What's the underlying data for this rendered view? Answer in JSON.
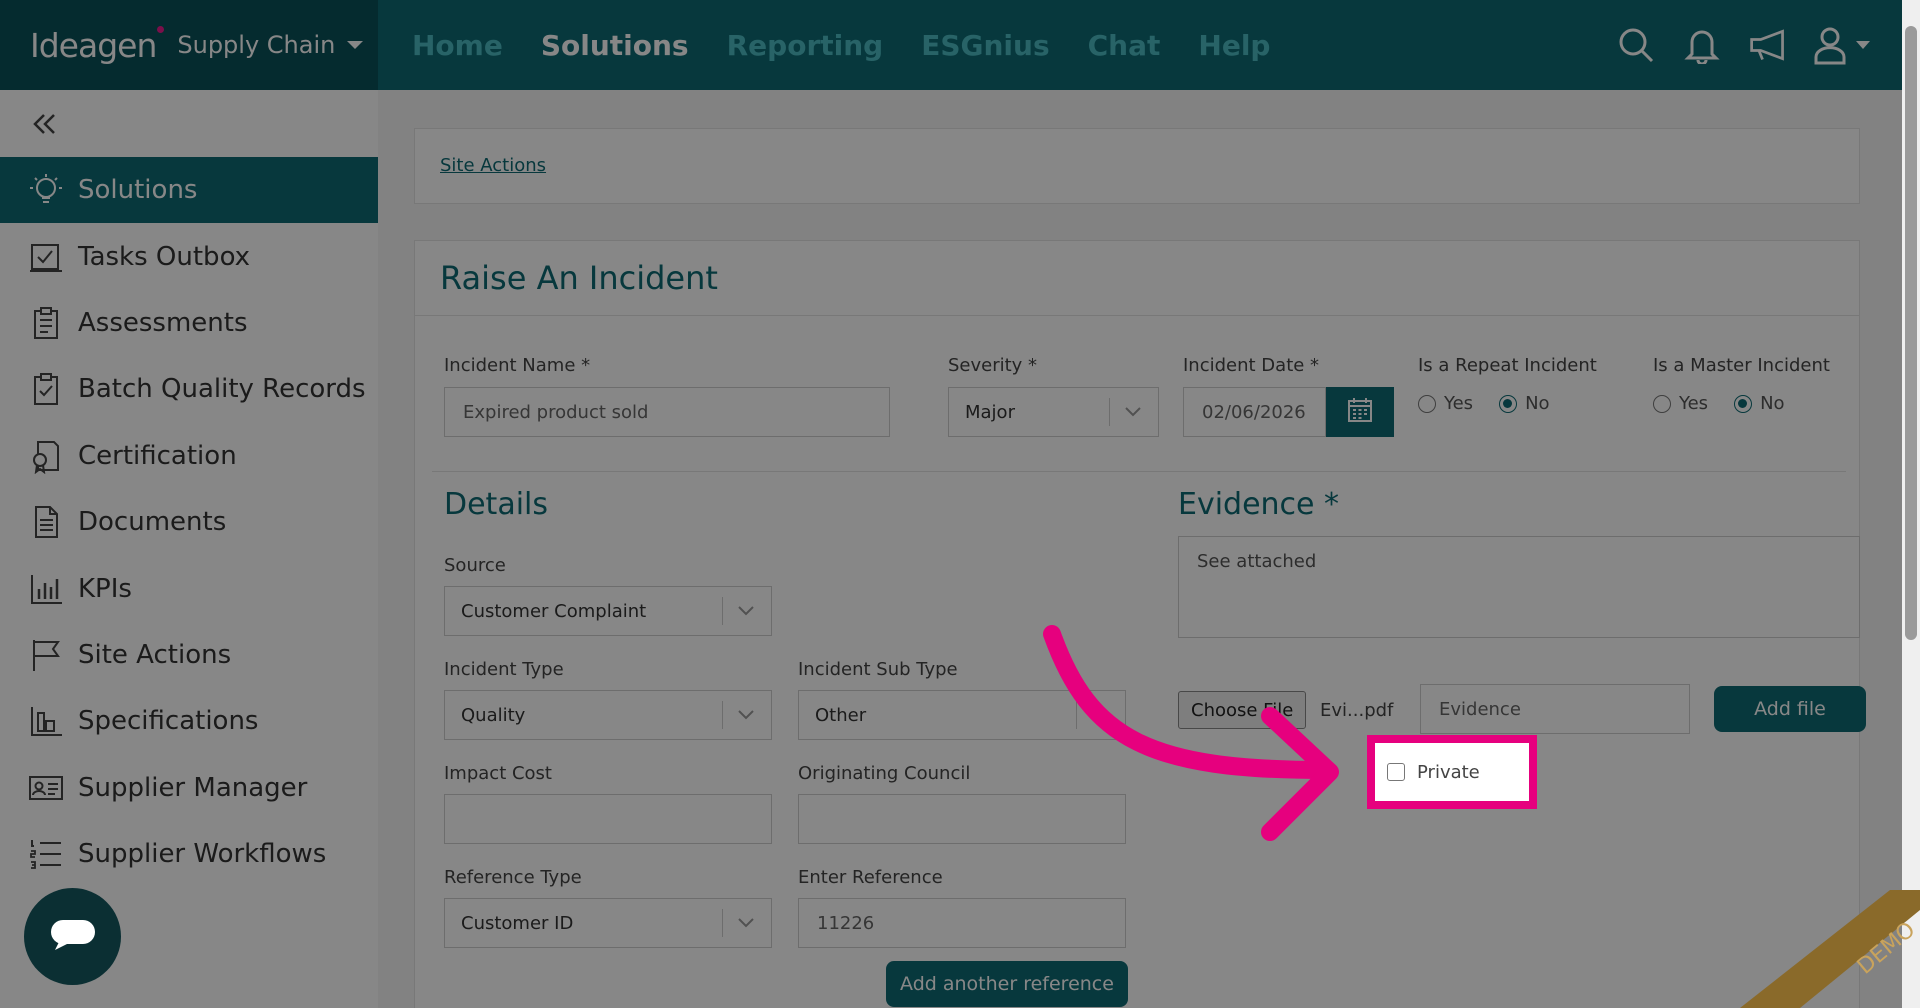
{
  "brand": {
    "logo": "Ideagen",
    "product": "Supply Chain"
  },
  "nav": [
    "Home",
    "Solutions",
    "Reporting",
    "ESGnius",
    "Chat",
    "Help"
  ],
  "nav_active_index": 1,
  "topicons": [
    "search-icon",
    "bell-icon",
    "megaphone-icon",
    "user-icon"
  ],
  "sidebar": {
    "items": [
      {
        "label": "Solutions",
        "icon": "lightbulb-icon"
      },
      {
        "label": "Tasks Outbox",
        "icon": "tasks-icon"
      },
      {
        "label": "Assessments",
        "icon": "clipboard-icon"
      },
      {
        "label": "Batch Quality Records",
        "icon": "clipboard-check-icon"
      },
      {
        "label": "Certification",
        "icon": "certificate-icon"
      },
      {
        "label": "Documents",
        "icon": "document-icon"
      },
      {
        "label": "KPIs",
        "icon": "chart-icon"
      },
      {
        "label": "Site Actions",
        "icon": "flag-icon"
      },
      {
        "label": "Specifications",
        "icon": "specs-icon"
      },
      {
        "label": "Supplier Manager",
        "icon": "id-card-icon"
      },
      {
        "label": "Supplier Workflows",
        "icon": "numbered-list-icon"
      }
    ],
    "active_index": 0
  },
  "breadcrumb": "Site Actions",
  "form": {
    "title": "Raise An Incident",
    "incident_name": {
      "label": "Incident Name *",
      "value": "Expired product sold"
    },
    "severity": {
      "label": "Severity *",
      "value": "Major"
    },
    "incident_date": {
      "label": "Incident Date *",
      "value": "02/06/2026"
    },
    "repeat": {
      "label": "Is a Repeat Incident",
      "yes": "Yes",
      "no": "No",
      "selected": "No"
    },
    "master": {
      "label": "Is a Master Incident",
      "yes": "Yes",
      "no": "No",
      "selected": "No"
    },
    "details_heading": "Details",
    "source": {
      "label": "Source",
      "value": "Customer Complaint"
    },
    "incident_type": {
      "label": "Incident Type",
      "value": "Quality"
    },
    "incident_sub_type": {
      "label": "Incident Sub Type",
      "value": "Other"
    },
    "impact_cost": {
      "label": "Impact Cost",
      "value": ""
    },
    "originating_council": {
      "label": "Originating Council",
      "value": ""
    },
    "reference_type": {
      "label": "Reference Type",
      "value": "Customer ID"
    },
    "enter_reference": {
      "label": "Enter Reference",
      "value": "11226"
    },
    "add_reference_button": "Add another reference",
    "evidence_heading": "Evidence *",
    "evidence_text": "See attached",
    "choose_file_button": "Choose File",
    "file_name": "Evi...pdf",
    "evidence_input": "Evidence",
    "add_file_button": "Add file",
    "private_label": "Private"
  },
  "ribbon": "DEMO",
  "colors": {
    "primary": "#0e6b73",
    "brand_dark": "#0b5159",
    "highlight": "#e6007e"
  }
}
